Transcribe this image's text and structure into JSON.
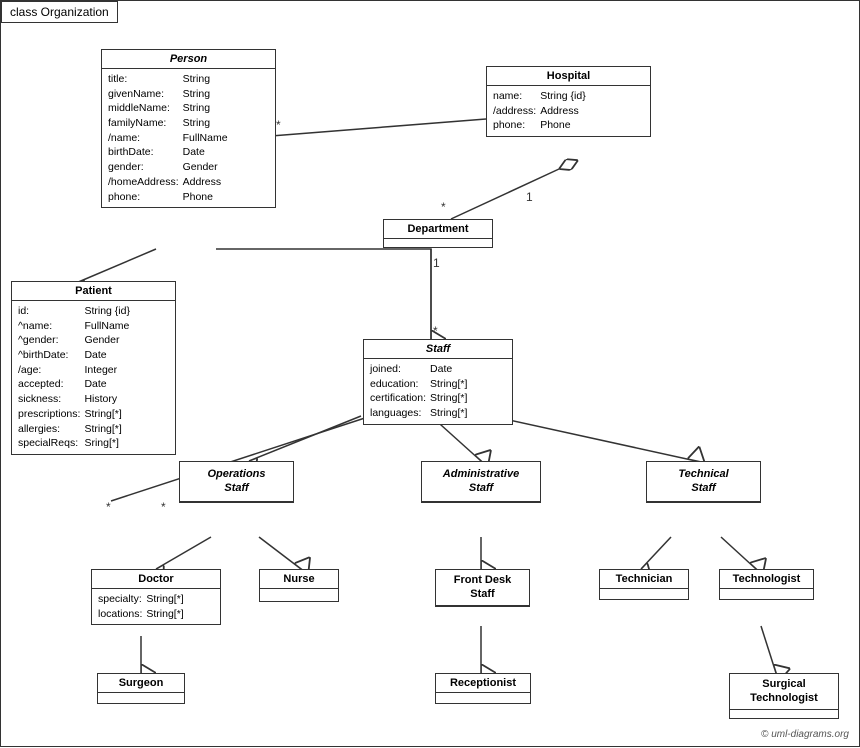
{
  "title": "class Organization",
  "copyright": "© uml-diagrams.org",
  "boxes": {
    "person": {
      "name": "Person",
      "italic": true,
      "attrs": [
        [
          "title:",
          "String"
        ],
        [
          "givenName:",
          "String"
        ],
        [
          "middleName:",
          "String"
        ],
        [
          "familyName:",
          "String"
        ],
        [
          "/name:",
          "FullName"
        ],
        [
          "birthDate:",
          "Date"
        ],
        [
          "gender:",
          "Gender"
        ],
        [
          "/homeAddress:",
          "Address"
        ],
        [
          "phone:",
          "Phone"
        ]
      ]
    },
    "hospital": {
      "name": "Hospital",
      "italic": false,
      "attrs": [
        [
          "name:",
          "String {id}"
        ],
        [
          "/address:",
          "Address"
        ],
        [
          "phone:",
          "Phone"
        ]
      ]
    },
    "patient": {
      "name": "Patient",
      "italic": false,
      "attrs": [
        [
          "id:",
          "String {id}"
        ],
        [
          "^name:",
          "FullName"
        ],
        [
          "^gender:",
          "Gender"
        ],
        [
          "^birthDate:",
          "Date"
        ],
        [
          "/age:",
          "Integer"
        ],
        [
          "accepted:",
          "Date"
        ],
        [
          "sickness:",
          "History"
        ],
        [
          "prescriptions:",
          "String[*]"
        ],
        [
          "allergies:",
          "String[*]"
        ],
        [
          "specialReqs:",
          "Sring[*]"
        ]
      ]
    },
    "department": {
      "name": "Department",
      "italic": false,
      "attrs": []
    },
    "staff": {
      "name": "Staff",
      "italic": true,
      "attrs": [
        [
          "joined:",
          "Date"
        ],
        [
          "education:",
          "String[*]"
        ],
        [
          "certification:",
          "String[*]"
        ],
        [
          "languages:",
          "String[*]"
        ]
      ]
    },
    "operations_staff": {
      "name": "Operations\nStaff",
      "italic": true,
      "attrs": []
    },
    "administrative_staff": {
      "name": "Administrative\nStaff",
      "italic": true,
      "attrs": []
    },
    "technical_staff": {
      "name": "Technical\nStaff",
      "italic": true,
      "attrs": []
    },
    "doctor": {
      "name": "Doctor",
      "italic": false,
      "attrs": [
        [
          "specialty:",
          "String[*]"
        ],
        [
          "locations:",
          "String[*]"
        ]
      ]
    },
    "nurse": {
      "name": "Nurse",
      "italic": false,
      "attrs": []
    },
    "front_desk_staff": {
      "name": "Front Desk\nStaff",
      "italic": false,
      "attrs": []
    },
    "technician": {
      "name": "Technician",
      "italic": false,
      "attrs": []
    },
    "technologist": {
      "name": "Technologist",
      "italic": false,
      "attrs": []
    },
    "surgeon": {
      "name": "Surgeon",
      "italic": false,
      "attrs": []
    },
    "receptionist": {
      "name": "Receptionist",
      "italic": false,
      "attrs": []
    },
    "surgical_technologist": {
      "name": "Surgical\nTechnologist",
      "italic": false,
      "attrs": []
    }
  }
}
